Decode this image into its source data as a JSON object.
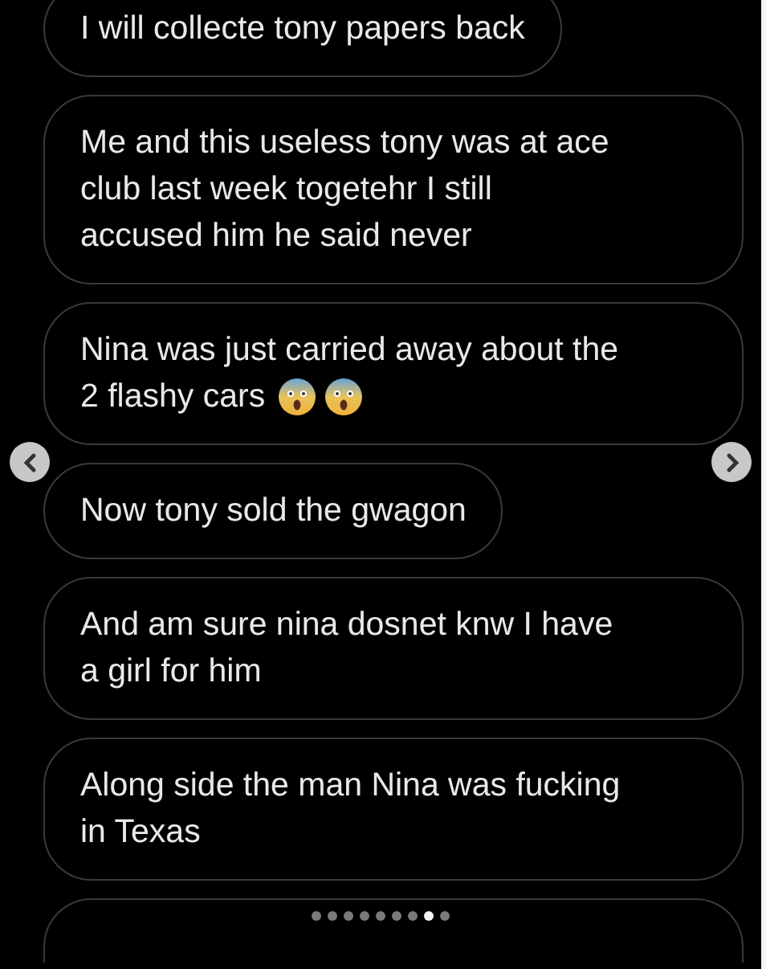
{
  "messages": [
    {
      "kind": "text",
      "text": "I will collecte tony papers back"
    },
    {
      "kind": "text",
      "text": "Me and this useless tony was at ace\nclub last week togetehr I still\naccused him he said never"
    },
    {
      "kind": "emoji",
      "text": "Nina was just carried away about the\n2 flashy cars"
    },
    {
      "kind": "text",
      "text": "Now tony sold the gwagon"
    },
    {
      "kind": "text",
      "text": "And am sure nina dosnet knw I have\na girl for him"
    },
    {
      "kind": "text",
      "text": "Along side the man Nina was fucking\nin Texas"
    }
  ],
  "pager": [
    {
      "selected": false
    },
    {
      "selected": false
    },
    {
      "selected": false
    },
    {
      "selected": false
    },
    {
      "selected": false
    },
    {
      "selected": false
    },
    {
      "selected": false
    },
    {
      "selected": true
    },
    {
      "selected": false
    }
  ]
}
